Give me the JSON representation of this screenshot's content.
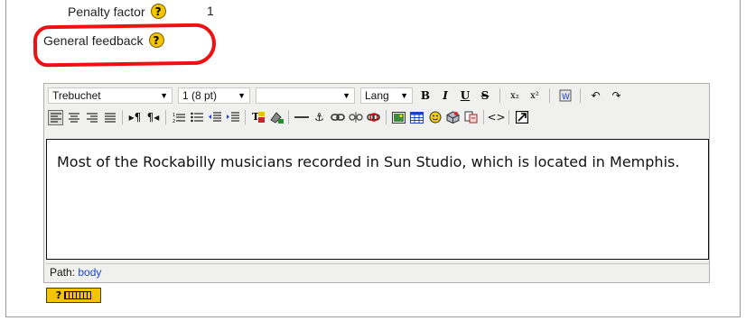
{
  "penalty": {
    "label": "Penalty factor",
    "value": "1"
  },
  "feedback": {
    "label": "General feedback"
  },
  "help_glyph": "?",
  "toolbar": {
    "font_family": "Trebuchet",
    "font_size": "1 (8 pt)",
    "format": "",
    "lang": "Lang",
    "bold": "B",
    "italic": "I",
    "underline": "U",
    "strike": "S",
    "subscript": "x₂",
    "superscript": "x²"
  },
  "editor": {
    "content": "Most of the Rockabilly musicians recorded in Sun Studio, which is located in Memphis."
  },
  "path": {
    "label": "Path:",
    "value": "body"
  },
  "colors": {
    "annotation": "#ee1111",
    "help_icon": "#f5c400",
    "link": "#1a44c6"
  }
}
